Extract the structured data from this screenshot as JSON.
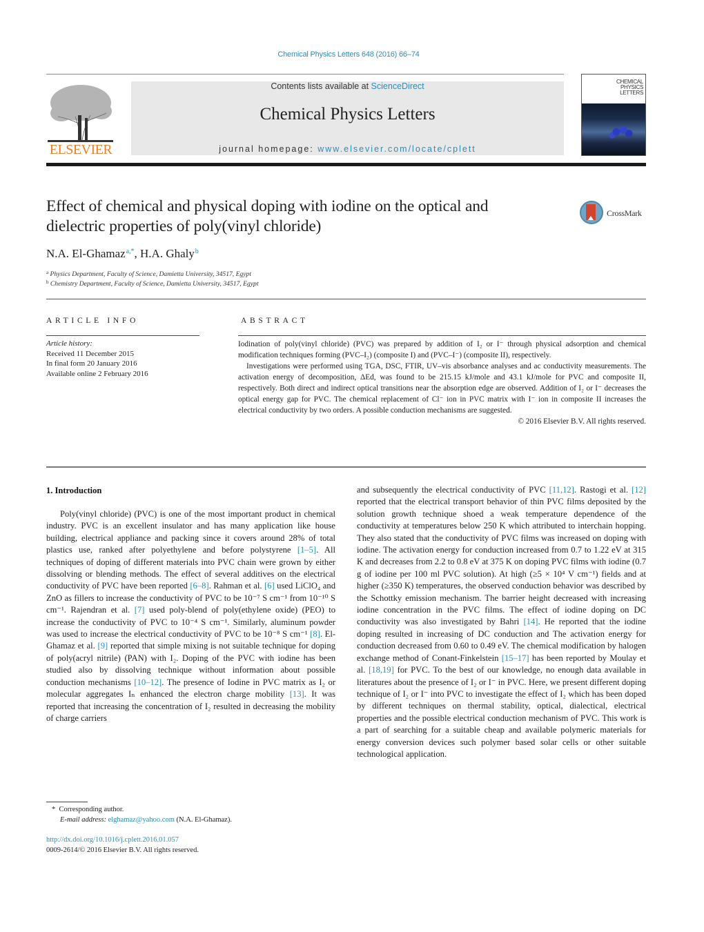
{
  "header": {
    "journal_ref": "Chemical Physics Letters 648 (2016) 66–74",
    "contents_prefix": "Contents lists available at ",
    "contents_link": "ScienceDirect",
    "journal_title": "Chemical Physics Letters",
    "homepage_prefix": "journal homepage: ",
    "homepage_link": "www.elsevier.com/locate/cplett",
    "publisher_logo_text": "ELSEVIER",
    "cover_title_lines": [
      "CHEMICAL",
      "PHYSICS",
      "LETTERS"
    ],
    "brand_orange": "#f07e26",
    "link_color": "#2a8db8"
  },
  "article": {
    "title_line1": "Effect of chemical and physical doping with iodine on the optical and",
    "title_line2": "dielectric properties of poly(vinyl chloride)",
    "crossmark_label": "CrossMark",
    "authors": [
      {
        "name": "N.A. El-Ghamaz",
        "marks": "a,*"
      },
      {
        "name": "H.A. Ghaly",
        "marks": "b"
      }
    ],
    "author_separator": ", ",
    "affiliations": [
      {
        "mark": "a",
        "text": "Physics Department, Faculty of Science, Damietta University, 34517, Egypt"
      },
      {
        "mark": "b",
        "text": "Chemistry Department, Faculty of Science, Damietta University, 34517, Egypt"
      }
    ]
  },
  "article_info": {
    "heading": "ARTICLE INFO",
    "history_label": "Article history:",
    "received": "Received 11 December 2015",
    "final_form": "In final form 20 January 2016",
    "available": "Available online 2 February 2016"
  },
  "abstract": {
    "heading": "ABSTRACT",
    "p1": "Iodination of poly(vinyl chloride) (PVC) was prepared by addition of I₂ or I⁻ through physical adsorption and chemical modification techniques forming (PVC–I₂) (composite I) and (PVC–I⁻) (composite II), respectively.",
    "p2": "Investigations were performed using TGA, DSC, FTIR, UV–vis absorbance analyses and ac conductivity measurements. The activation energy of decomposition, ΔEd, was found to be 215.15 kJ/mole and 43.1 kJ/mole for PVC and composite II, respectively. Both direct and indirect optical transitions near the absorption edge are observed. Addition of I₂ or I⁻ decreases the optical energy gap for PVC. The chemical replacement of Cl⁻ ion in PVC matrix with I⁻ ion in composite II increases the electrical conductivity by two orders. A possible conduction mechanisms are suggested.",
    "copyright": "© 2016 Elsevier B.V. All rights reserved."
  },
  "body": {
    "section_heading": "1.  Introduction",
    "left_column": "Poly(vinyl chloride) (PVC) is one of the most important product in chemical industry. PVC is an excellent insulator and has many application like house building, electrical appliance and packing since it covers around 28% of total plastics use, ranked after polyethylene and before polystyrene [1–5]. All techniques of doping of different materials into PVC chain were grown by either dissolving or blending methods. The effect of several additives on the electrical conductivity of PVC have been reported [6–8]. Rahman et al. [6] used LiClO₄ and ZnO as fillers to increase the conductivity of PVC to be 10⁻⁷ S cm⁻¹ from 10⁻¹⁰ S cm⁻¹. Rajendran et al. [7] used poly-blend of poly(ethylene oxide) (PEO) to increase the conductivity of PVC to 10⁻⁴ S cm⁻¹. Similarly, aluminum powder was used to increase the electrical conductivity of PVC to be 10⁻⁸ S cm⁻¹ [8]. El-Ghamaz et al. [9] reported that simple mixing is not suitable technique for doping of poly(acryl nitrile) (PAN) with I₂. Doping of the PVC with iodine has been studied also by dissolving technique without information about possible conduction mechanisms [10–12]. The presence of Iodine in PVC matrix as I₂ or molecular aggregates Iₙ enhanced the electron charge mobility [13]. It was reported that increasing the concentration of I₂ resulted in decreasing the mobility of charge carriers",
    "right_column": "and subsequently the electrical conductivity of PVC [11,12]. Rastogi et al. [12] reported that the electrical transport behavior of thin PVC films deposited by the solution growth technique shoed a weak temperature dependence of the conductivity at temperatures below 250 K which attributed to interchain hopping. They also stated that the conductivity of PVC films was increased on doping with iodine. The activation energy for conduction increased from 0.7 to 1.22 eV at 315 K and decreases from 2.2 to 0.8 eV at 375 K on doping PVC films with iodine (0.7 g of iodine per 100 ml PVC solution). At high (≥5 × 10⁴ V cm⁻¹) fields and at higher (≥350 K) temperatures, the observed conduction behavior was described by the Schottky emission mechanism. The barrier height decreased with increasing iodine concentration in the PVC films. The effect of iodine doping on DC conductivity was also investigated by Bahri [14]. He reported that the iodine doping resulted in increasing of DC conduction and The activation energy for conduction decreased from 0.60 to 0.49 eV. The chemical modification by halogen exchange method of Conant-Finkelstein [15–17] has been reported by Moulay et al. [18,19] for PVC. To the best of our knowledge, no enough data available in literatures about the presence of I₂ or I⁻ in PVC. Here, we present different doping technique of I₂ or I⁻ into PVC to investigate the effect of I₂ which has been doped by different techniques on thermal stability, optical, dialectical, electrical properties and the possible electrical conduction mechanism of PVC. This work is a part of searching for a suitable cheap and available polymeric materials for energy conversion devices such polymer based solar cells or other suitable technological application.",
    "citations": [
      "[1–5]",
      "[6–8]",
      "[6]",
      "[7]",
      "[8]",
      "[9]",
      "[10–12]",
      "[13]",
      "[11,12]",
      "[12]",
      "[14]",
      "[15–17]",
      "[18,19]"
    ]
  },
  "footer": {
    "footnote_mark": "*",
    "corresponding": "Corresponding author.",
    "email_label": "E-mail address: ",
    "email": "elghamaz@yahoo.com",
    "email_owner": " (N.A. El-Ghamaz).",
    "doi": "http://dx.doi.org/10.1016/j.cplett.2016.01.057",
    "issn_copyright": "0009-2614/© 2016 Elsevier B.V. All rights reserved."
  }
}
